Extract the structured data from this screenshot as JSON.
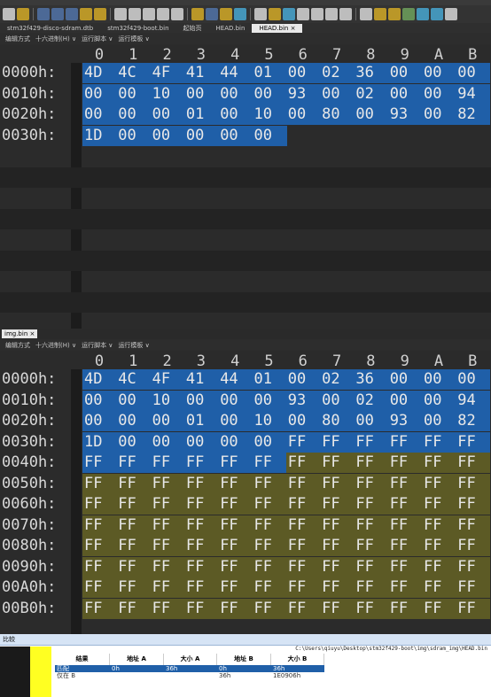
{
  "file_tabs": [
    "stm32f429-disco-sdram.dtb",
    "stm32f429-boot.bin",
    "起始页",
    "HEAD.bin",
    "HEAD.bin ×"
  ],
  "active_tab_index": 4,
  "options_bar": {
    "edit_mode": "编辑方式",
    "hex_mode": "十六进制(H) ∨",
    "run_script": "运行脚本 ∨",
    "run_template": "运行模板 ∨"
  },
  "columns": [
    "0",
    "1",
    "2",
    "3",
    "4",
    "5",
    "6",
    "7",
    "8",
    "9",
    "A",
    "B"
  ],
  "top_editor": {
    "rows": [
      {
        "addr": "0000h:",
        "bytes": [
          "4D",
          "4C",
          "4F",
          "41",
          "44",
          "01",
          "00",
          "02",
          "36",
          "00",
          "00",
          "00"
        ]
      },
      {
        "addr": "0010h:",
        "bytes": [
          "00",
          "00",
          "10",
          "00",
          "00",
          "00",
          "93",
          "00",
          "02",
          "00",
          "00",
          "94"
        ]
      },
      {
        "addr": "0020h:",
        "bytes": [
          "00",
          "00",
          "00",
          "01",
          "00",
          "10",
          "00",
          "80",
          "00",
          "93",
          "00",
          "82"
        ]
      },
      {
        "addr": "0030h:",
        "bytes": [
          "1D",
          "00",
          "00",
          "00",
          "00",
          "00",
          "",
          "",
          "",
          "",
          "",
          ""
        ]
      }
    ]
  },
  "second_tab": "img.bin ×",
  "bottom_editor": {
    "rows": [
      {
        "addr": "0000h:",
        "bytes": [
          "4D",
          "4C",
          "4F",
          "41",
          "44",
          "01",
          "00",
          "02",
          "36",
          "00",
          "00",
          "00"
        ]
      },
      {
        "addr": "0010h:",
        "bytes": [
          "00",
          "00",
          "10",
          "00",
          "00",
          "00",
          "93",
          "00",
          "02",
          "00",
          "00",
          "94"
        ]
      },
      {
        "addr": "0020h:",
        "bytes": [
          "00",
          "00",
          "00",
          "01",
          "00",
          "10",
          "00",
          "80",
          "00",
          "93",
          "00",
          "82"
        ]
      },
      {
        "addr": "0030h:",
        "bytes": [
          "1D",
          "00",
          "00",
          "00",
          "00",
          "00",
          "FF",
          "FF",
          "FF",
          "FF",
          "FF",
          "FF"
        ]
      },
      {
        "addr": "0040h:",
        "bytes": [
          "FF",
          "FF",
          "FF",
          "FF",
          "FF",
          "FF",
          "FF",
          "FF",
          "FF",
          "FF",
          "FF",
          "FF"
        ]
      },
      {
        "addr": "0050h:",
        "bytes": [
          "FF",
          "FF",
          "FF",
          "FF",
          "FF",
          "FF",
          "FF",
          "FF",
          "FF",
          "FF",
          "FF",
          "FF"
        ]
      },
      {
        "addr": "0060h:",
        "bytes": [
          "FF",
          "FF",
          "FF",
          "FF",
          "FF",
          "FF",
          "FF",
          "FF",
          "FF",
          "FF",
          "FF",
          "FF"
        ]
      },
      {
        "addr": "0070h:",
        "bytes": [
          "FF",
          "FF",
          "FF",
          "FF",
          "FF",
          "FF",
          "FF",
          "FF",
          "FF",
          "FF",
          "FF",
          "FF"
        ]
      },
      {
        "addr": "0080h:",
        "bytes": [
          "FF",
          "FF",
          "FF",
          "FF",
          "FF",
          "FF",
          "FF",
          "FF",
          "FF",
          "FF",
          "FF",
          "FF"
        ]
      },
      {
        "addr": "0090h:",
        "bytes": [
          "FF",
          "FF",
          "FF",
          "FF",
          "FF",
          "FF",
          "FF",
          "FF",
          "FF",
          "FF",
          "FF",
          "FF"
        ]
      },
      {
        "addr": "00A0h:",
        "bytes": [
          "FF",
          "FF",
          "FF",
          "FF",
          "FF",
          "FF",
          "FF",
          "FF",
          "FF",
          "FF",
          "FF",
          "FF"
        ]
      },
      {
        "addr": "00B0h:",
        "bytes": [
          "FF",
          "FF",
          "FF",
          "FF",
          "FF",
          "FF",
          "FF",
          "FF",
          "FF",
          "FF",
          "FF",
          "FF"
        ]
      }
    ]
  },
  "compare": {
    "title": "比较",
    "path": "C:\\Users\\qiuyu\\Desktop\\stm32f429-boot\\img\\sdram_img\\HEAD.bin",
    "headers": [
      "结果",
      "地址 A",
      "大小 A",
      "地址 B",
      "大小 B"
    ],
    "rows": [
      {
        "result": "匹配",
        "addr_a": "0h",
        "size_a": "36h",
        "addr_b": "0h",
        "size_b": "36h"
      },
      {
        "result": "仅在 B",
        "addr_a": "",
        "size_a": "",
        "addr_b": "36h",
        "size_b": "1E0906h"
      }
    ]
  },
  "colors": {
    "selection": "#1f5fa8",
    "difference": "#5c5a25",
    "compare_marker": "#ffff22"
  }
}
